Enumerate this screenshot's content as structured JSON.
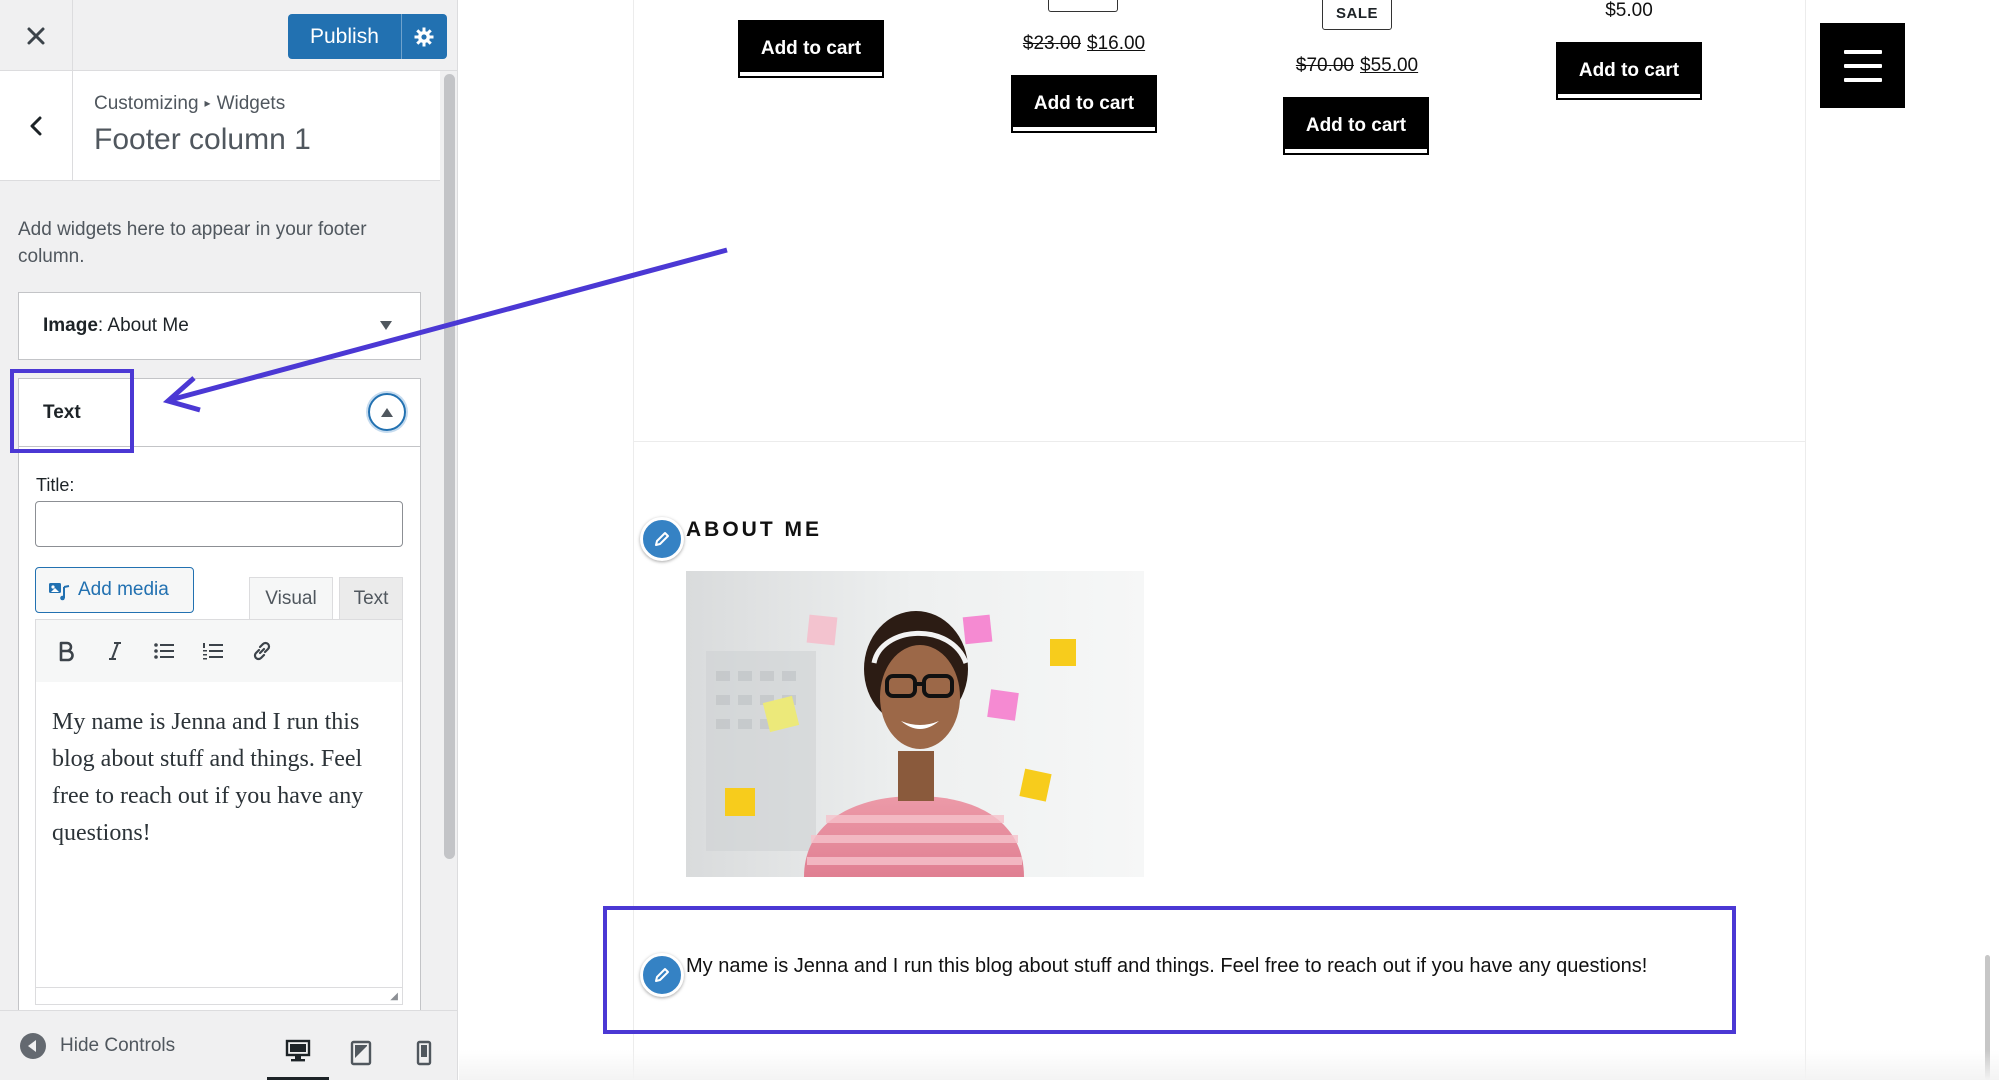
{
  "topbar": {
    "publish_label": "Publish"
  },
  "section": {
    "breadcrumb_root": "Customizing",
    "breadcrumb_child": "Widgets",
    "title": "Footer column 1"
  },
  "panel": {
    "description": "Add widgets here to appear in your footer column."
  },
  "widgets": {
    "image": {
      "type_label": "Image",
      "title": ": About Me"
    },
    "text": {
      "type_label": "Text",
      "title_label": "Title:",
      "title_value": "",
      "add_media_label": "Add media",
      "tab_visual": "Visual",
      "tab_text": "Text",
      "body": "My name is Jenna and I run this blog about stuff and things. Feel free to reach out if you have any questions!"
    }
  },
  "toolbar_buttons": [
    "bold-icon",
    "italic-icon",
    "bulleted-list-icon",
    "numbered-list-icon",
    "link-icon"
  ],
  "bottom_bar": {
    "hide_controls_label": "Hide Controls"
  },
  "preview": {
    "products": [
      {
        "button": "Add to cart"
      },
      {
        "price_old": "$23.00",
        "price_new": "$16.00",
        "button": "Add to cart"
      },
      {
        "badge": "SALE",
        "price_old": "$70.00",
        "price_new": "$55.00",
        "button": "Add to cart"
      },
      {
        "price": "$5.00",
        "button": "Add to cart"
      }
    ],
    "about_heading": "ABOUT ME",
    "about_text": "My name is Jenna and I run this blog about stuff and things. Feel free to reach out if you have any questions!"
  },
  "colors": {
    "accent": "#2271b1",
    "annotation": "#4b38d4",
    "edit_shortcut": "#3582c4"
  }
}
